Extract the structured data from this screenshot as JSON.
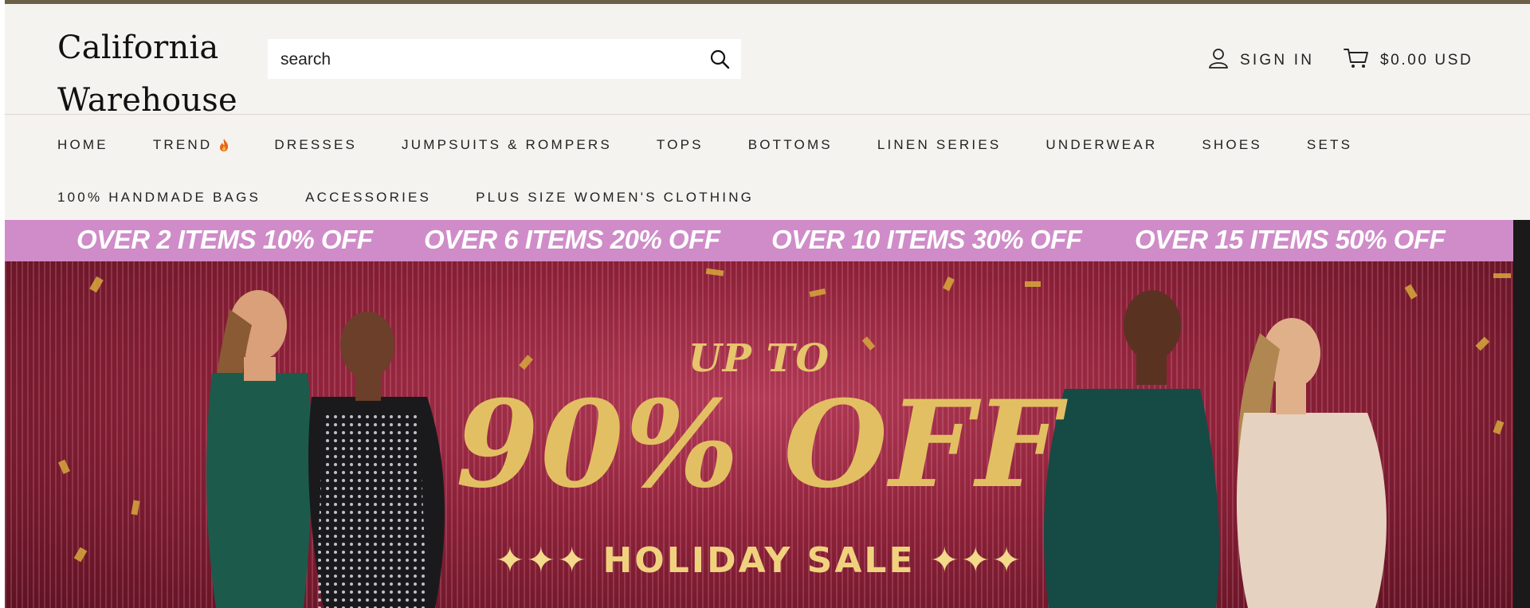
{
  "header": {
    "logo_line1": "California",
    "logo_line2": "Warehouse",
    "search_placeholder": "search",
    "signin_label": "SIGN IN",
    "cart_label": "$0.00 USD"
  },
  "nav": {
    "row1": [
      "HOME",
      "TREND",
      "DRESSES",
      "JUMPSUITS & ROMPERS",
      "TOPS",
      "BOTTOMS",
      "LINEN SERIES",
      "UNDERWEAR",
      "SHOES",
      "SETS"
    ],
    "row2": [
      "100% HANDMADE BAGS",
      "ACCESSORIES",
      "PLUS SIZE WOMEN'S CLOTHING"
    ]
  },
  "promo": {
    "items": [
      "OVER 2 ITEMS 10% OFF",
      "OVER 6 ITEMS 20% OFF",
      "OVER 10 ITEMS 30% OFF",
      "OVER 15 ITEMS 50% OFF"
    ]
  },
  "hero": {
    "upto": "UP TO",
    "headline": "90% OFF",
    "subline": "HOLIDAY SALE",
    "stars": "✦✦✦"
  },
  "colors": {
    "topbar": "#6b6148",
    "background": "#f5f3ef",
    "promo_bg": "#d08cc9",
    "hero_gold": "#e3bf63",
    "hero_bg": "#8c2138"
  },
  "icons": {
    "search": "search-icon",
    "user": "user-icon",
    "cart": "cart-icon",
    "flame": "flame-icon"
  }
}
